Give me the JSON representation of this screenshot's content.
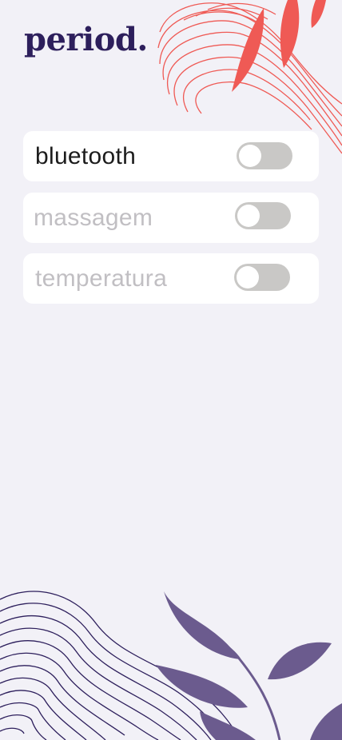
{
  "app": {
    "logo": "period."
  },
  "settings": [
    {
      "label": "bluetooth",
      "enabled": false,
      "state": "active"
    },
    {
      "label": "massagem",
      "enabled": false,
      "state": "inactive"
    },
    {
      "label": "temperatura",
      "enabled": false,
      "state": "inactive"
    }
  ],
  "colors": {
    "background": "#f2f1f7",
    "brand": "#2d1f5c",
    "accent_coral": "#ef5a55",
    "accent_purple": "#6b5b8e",
    "toggle_off": "#c9c8c6"
  },
  "icons": [
    "coral-wave-decoration",
    "purple-wave-decoration",
    "leaf-decoration"
  ]
}
